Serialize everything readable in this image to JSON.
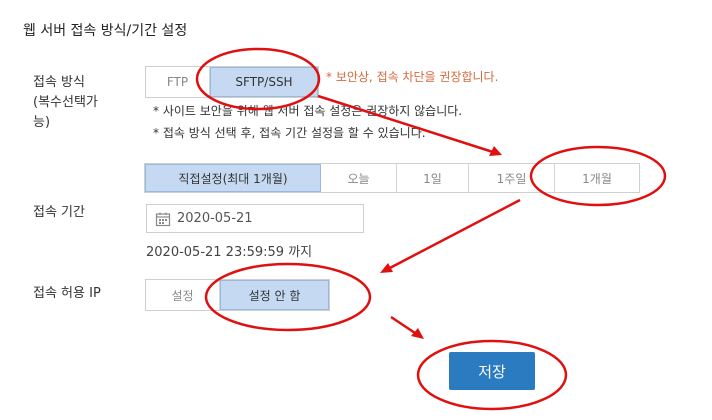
{
  "page": {
    "title": "웹 서버 접속 방식/기간 설정"
  },
  "access_method": {
    "label_line1": "접속 방식",
    "label_line2": "(복수선택가",
    "label_line3": "능)",
    "options": [
      "FTP",
      "SFTP/SSH"
    ],
    "selected": "SFTP/SSH",
    "warning": "* 보안상, 접속 차단을 권장합니다.",
    "note1": "* 사이트 보안을 위해 웹 서버 접속 설정은 권장하지 않습니다.",
    "note2": "* 접속 방식 선택 후, 접속 기간 설정을 할 수 있습니다."
  },
  "access_period": {
    "label": "접속 기간",
    "options": [
      "직접설정(최대 1개월)",
      "오늘",
      "1일",
      "1주일",
      "1개월"
    ],
    "selected": "직접설정(최대 1개월)",
    "date_value": "2020-05-21",
    "until_text": "2020-05-21 23:59:59 까지"
  },
  "allowed_ip": {
    "label": "접속 허용 IP",
    "options": [
      "설정",
      "설정 안 함"
    ],
    "selected": "설정 안 함"
  },
  "save_button": {
    "label": "저장"
  },
  "annotation_color": "#e01010",
  "accent_color": "#2b7bc0",
  "warning_color": "#d06b3c"
}
